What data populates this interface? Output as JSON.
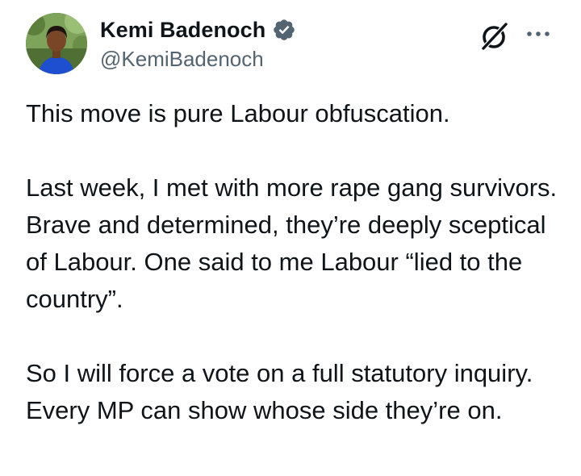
{
  "author": {
    "display_name": "Kemi Badenoch",
    "handle": "@KemiBadenoch",
    "verified": true,
    "verified_color": "#536471"
  },
  "icons": {
    "grok": "grok-icon",
    "more": "more-options-icon",
    "verified": "verified-badge-icon"
  },
  "tweet": {
    "paragraphs": [
      "This move is pure Labour obfuscation.",
      "Last week, I met with more rape gang survivors. Brave and determined, they’re deeply sceptical of Labour. One said to me Labour “lied to the country”.",
      "So I will force a vote on a full statutory inquiry. Every MP can show whose side they’re on."
    ]
  },
  "colors": {
    "text": "#0f1419",
    "secondary": "#536471",
    "background": "#ffffff"
  }
}
